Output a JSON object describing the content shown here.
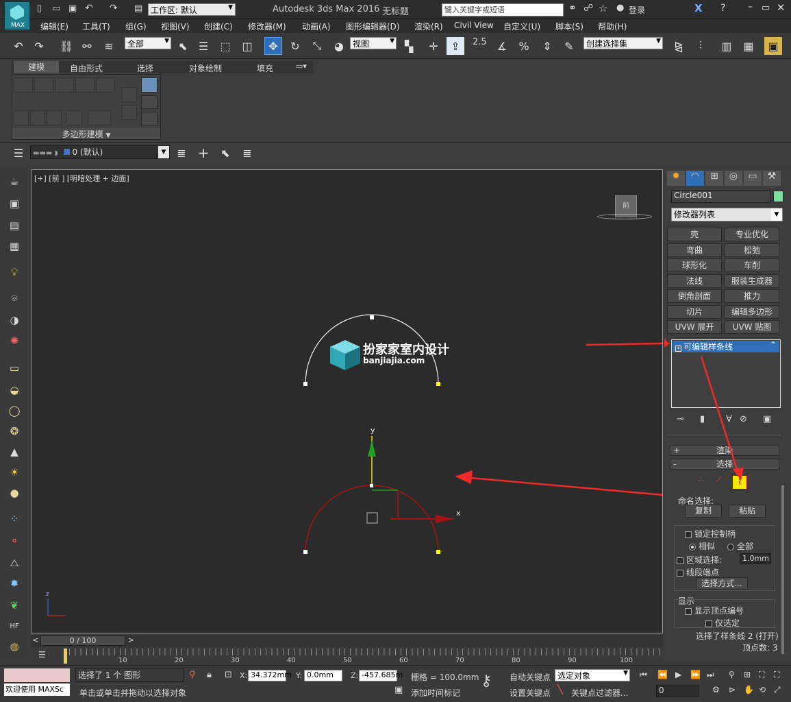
{
  "app": {
    "title": "Autodesk 3ds Max 2016",
    "doc": "无标题",
    "logo": "MAX",
    "workspace": "工作区: 默认",
    "search_placeholder": "键入关键字或短语",
    "login": "登录"
  },
  "menu": [
    "编辑(E)",
    "工具(T)",
    "组(G)",
    "视图(V)",
    "创建(C)",
    "修改器(M)",
    "动画(A)",
    "图形编辑器(D)",
    "渲染(R)",
    "Civil View",
    "自定义(U)",
    "脚本(S)",
    "帮助(H)"
  ],
  "toolbar": {
    "filter": "全部",
    "refcoord": "视图",
    "snap_label": "2.5",
    "selset": "创建选择集"
  },
  "ribbon": {
    "tabs": [
      "建模",
      "自由形式",
      "选择",
      "对象绘制",
      "填充"
    ],
    "panel_label": "多边形建模"
  },
  "layer": {
    "name": "0 (默认)"
  },
  "viewport": {
    "label": "[+] [前 ] [明暗处理 + 边面]",
    "watermark_title": "扮家家室内设计",
    "watermark_url": "banjiajia.com",
    "cube_label": "前",
    "axis_y": "y",
    "axis_x": "x",
    "mini_z": "z"
  },
  "cmd": {
    "object_name": "Circle001",
    "modifier_list": "修改器列表",
    "object_color": "#7ee0a0",
    "modifiers": [
      "壳",
      "专业优化",
      "弯曲",
      "松弛",
      "球形化",
      "车削",
      "法线",
      "服装生成器",
      "倒角剖面",
      "推力",
      "切片",
      "编辑多边形",
      "UVW 展开",
      "UVW 贴图"
    ],
    "stack_item": "可编辑样条线",
    "rollouts": {
      "render": "渲染",
      "select": "选择"
    },
    "named_sel": "命名选择:",
    "copy": "复制",
    "paste": "粘贴",
    "lock_handles": "锁定控制柄",
    "similar": "相似",
    "all": "全部",
    "area_sel": "区域选择:",
    "area_val": "1.0mm",
    "seg_end": "线段端点",
    "select_by": "选择方式...",
    "display": "显示",
    "show_vert_num": "显示顶点编号",
    "only_selected": "仅选定",
    "sel_info": "选择了样条线 2 (打开)",
    "vert_count": "顶点数: 3"
  },
  "time": {
    "frame": "0 / 100",
    "ticks": [
      "10",
      "20",
      "30",
      "40",
      "50",
      "60",
      "70",
      "80",
      "90",
      "100"
    ]
  },
  "status": {
    "welcome": "欢迎使用 MAXSc",
    "selected": "选择了 1 个 图形",
    "prompt": "单击或单击并拖动以选择对象",
    "x_label": "X:",
    "x": "34.372mm",
    "y_label": "Y:",
    "y": "0.0mm",
    "z_label": "Z:",
    "z": "-457.685m",
    "grid": "栅格 = 100.0mm",
    "add_tag": "添加时间标记",
    "auto_key": "自动关键点",
    "set_key": "设置关键点",
    "sel_obj": "选定对象",
    "key_filter": "关键点过滤器...",
    "frame_field": "0"
  }
}
